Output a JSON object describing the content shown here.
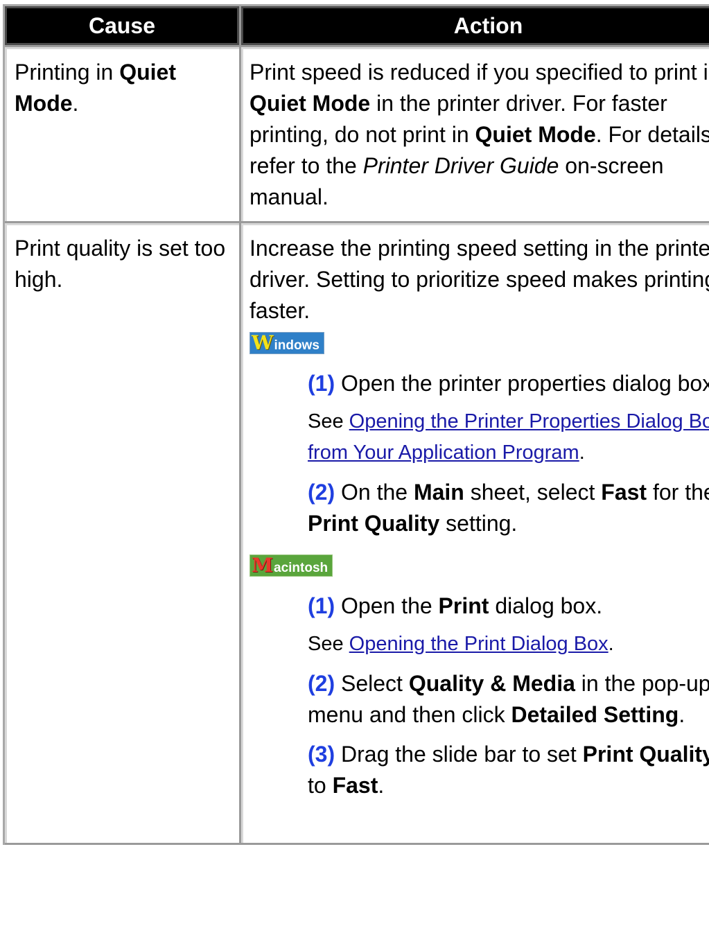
{
  "table": {
    "headers": {
      "cause": "Cause",
      "action": "Action"
    },
    "row1": {
      "cause": {
        "pre": "Printing in ",
        "bold": "Quiet Mode",
        "post": "."
      },
      "action": {
        "t1": "Print speed is reduced if you specified to print in ",
        "b1": "Quiet Mode",
        "t2": " in the printer driver. For faster printing, do not print in ",
        "b2": "Quiet Mode",
        "t3": ". For details, refer to the ",
        "i1": "Printer Driver Guide",
        "t4": " on-screen manual."
      }
    },
    "row2": {
      "cause": "Print quality is set too high.",
      "intro": "Increase the printing speed setting in the printer driver. Setting to prioritize speed makes printing faster.",
      "windows": {
        "logo_initial": "W",
        "logo_rest": "indows",
        "step1": {
          "num": "(1)",
          "text": " Open the printer properties dialog box."
        },
        "see": {
          "prefix": "See ",
          "link": "Opening the Printer Properties Dialog Box from Your Application Program",
          "suffix": "."
        },
        "step2": {
          "num": "(2)",
          "t1": " On the ",
          "b1": "Main",
          "t2": " sheet, select ",
          "b2": "Fast",
          "t3": " for the ",
          "b3": "Print Quality",
          "t4": " setting."
        }
      },
      "macintosh": {
        "logo_initial": "M",
        "logo_rest": "acintosh",
        "step1": {
          "num": "(1)",
          "t1": " Open the ",
          "b1": "Print",
          "t2": " dialog box."
        },
        "see": {
          "prefix": "See ",
          "link": "Opening the Print Dialog Box",
          "suffix": "."
        },
        "step2": {
          "num": "(2)",
          "t1": " Select ",
          "b1": "Quality & Media",
          "t2": " in the pop-up menu and then click ",
          "b2": "Detailed Setting",
          "t3": "."
        },
        "step3": {
          "num": "(3)",
          "t1": " Drag the slide bar to set ",
          "b1": "Print Quality",
          "t2": " to ",
          "b2": "Fast",
          "t3": "."
        }
      }
    }
  },
  "colors": {
    "header_bg": "#000000",
    "header_text": "#ffffff",
    "step_number": "#1f3fe0",
    "link": "#1a1aa8",
    "windows_logo": "#2f80c8",
    "macintosh_logo": "#5aa53c"
  }
}
